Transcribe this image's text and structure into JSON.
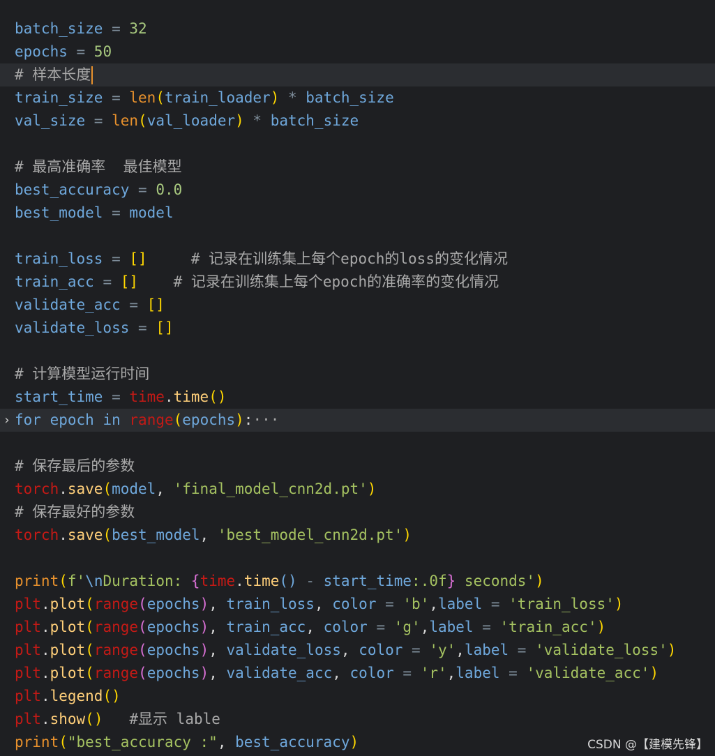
{
  "colors": {
    "background": "#1e1f22",
    "variable": "#6fa8dc",
    "operator": "#7d8c99",
    "number": "#a8c97f",
    "bracket": "#ffd700",
    "paren_inner": "#da70d6",
    "builtin": "#e8912d",
    "module": "#c41a16",
    "method": "#ffcf7a",
    "string": "#a5c261",
    "comment": "#a9a9a9",
    "keyword": "#6fa8dc",
    "plain": "#d4d4d4"
  },
  "code_lines": [
    {
      "tokens": [
        {
          "t": "batch_size",
          "c": "variable"
        },
        {
          "t": " = ",
          "c": "operator"
        },
        {
          "t": "32",
          "c": "number"
        }
      ]
    },
    {
      "tokens": [
        {
          "t": "epochs",
          "c": "variable"
        },
        {
          "t": " = ",
          "c": "operator"
        },
        {
          "t": "50",
          "c": "number"
        }
      ]
    },
    {
      "current": true,
      "caret": true,
      "tokens": [
        {
          "t": "# 样本长度",
          "c": "comment"
        }
      ]
    },
    {
      "tokens": [
        {
          "t": "train_size",
          "c": "variable"
        },
        {
          "t": " = ",
          "c": "operator"
        },
        {
          "t": "len",
          "c": "builtin"
        },
        {
          "t": "(",
          "c": "bracket"
        },
        {
          "t": "train_loader",
          "c": "variable"
        },
        {
          "t": ")",
          "c": "bracket"
        },
        {
          "t": " * ",
          "c": "operator"
        },
        {
          "t": "batch_size",
          "c": "variable"
        }
      ]
    },
    {
      "tokens": [
        {
          "t": "val_size",
          "c": "variable"
        },
        {
          "t": " = ",
          "c": "operator"
        },
        {
          "t": "len",
          "c": "builtin"
        },
        {
          "t": "(",
          "c": "bracket"
        },
        {
          "t": "val_loader",
          "c": "variable"
        },
        {
          "t": ")",
          "c": "bracket"
        },
        {
          "t": " * ",
          "c": "operator"
        },
        {
          "t": "batch_size",
          "c": "variable"
        }
      ]
    },
    {
      "tokens": []
    },
    {
      "tokens": [
        {
          "t": "# 最高准确率  最佳模型",
          "c": "comment"
        }
      ]
    },
    {
      "tokens": [
        {
          "t": "best_accuracy",
          "c": "variable"
        },
        {
          "t": " = ",
          "c": "operator"
        },
        {
          "t": "0.0",
          "c": "number"
        }
      ]
    },
    {
      "tokens": [
        {
          "t": "best_model",
          "c": "variable"
        },
        {
          "t": " = ",
          "c": "operator"
        },
        {
          "t": "model",
          "c": "variable"
        }
      ]
    },
    {
      "tokens": []
    },
    {
      "tokens": [
        {
          "t": "train_loss",
          "c": "variable"
        },
        {
          "t": " = ",
          "c": "operator"
        },
        {
          "t": "[]",
          "c": "bracket"
        },
        {
          "t": "     # 记录在训练集上每个epoch的loss的变化情况",
          "c": "comment"
        }
      ]
    },
    {
      "tokens": [
        {
          "t": "train_acc",
          "c": "variable"
        },
        {
          "t": " = ",
          "c": "operator"
        },
        {
          "t": "[]",
          "c": "bracket"
        },
        {
          "t": "    # 记录在训练集上每个epoch的准确率的变化情况",
          "c": "comment"
        }
      ]
    },
    {
      "tokens": [
        {
          "t": "validate_acc",
          "c": "variable"
        },
        {
          "t": " = ",
          "c": "operator"
        },
        {
          "t": "[]",
          "c": "bracket"
        }
      ]
    },
    {
      "tokens": [
        {
          "t": "validate_loss",
          "c": "variable"
        },
        {
          "t": " = ",
          "c": "operator"
        },
        {
          "t": "[]",
          "c": "bracket"
        }
      ]
    },
    {
      "tokens": []
    },
    {
      "tokens": [
        {
          "t": "# 计算模型运行时间",
          "c": "comment"
        }
      ]
    },
    {
      "tokens": [
        {
          "t": "start_time",
          "c": "variable"
        },
        {
          "t": " = ",
          "c": "operator"
        },
        {
          "t": "time",
          "c": "module"
        },
        {
          "t": ".",
          "c": "plain"
        },
        {
          "t": "time",
          "c": "method"
        },
        {
          "t": "()",
          "c": "bracket"
        }
      ]
    },
    {
      "folded": true,
      "fold_arrow": "›",
      "tokens": [
        {
          "t": "for",
          "c": "keyword"
        },
        {
          "t": " epoch ",
          "c": "variable"
        },
        {
          "t": "in",
          "c": "keyword"
        },
        {
          "t": " ",
          "c": "plain"
        },
        {
          "t": "range",
          "c": "module"
        },
        {
          "t": "(",
          "c": "bracket"
        },
        {
          "t": "epochs",
          "c": "variable"
        },
        {
          "t": ")",
          "c": "bracket"
        },
        {
          "t": ":",
          "c": "plain"
        },
        {
          "t": "···",
          "c": "comment"
        }
      ]
    },
    {
      "tokens": []
    },
    {
      "tokens": [
        {
          "t": "# 保存最后的参数",
          "c": "comment"
        }
      ]
    },
    {
      "tokens": [
        {
          "t": "torch",
          "c": "module"
        },
        {
          "t": ".",
          "c": "plain"
        },
        {
          "t": "save",
          "c": "method"
        },
        {
          "t": "(",
          "c": "bracket"
        },
        {
          "t": "model",
          "c": "variable"
        },
        {
          "t": ", ",
          "c": "plain"
        },
        {
          "t": "'final_model_cnn2d.pt'",
          "c": "string"
        },
        {
          "t": ")",
          "c": "bracket"
        }
      ]
    },
    {
      "tokens": [
        {
          "t": "# 保存最好的参数",
          "c": "comment"
        }
      ]
    },
    {
      "tokens": [
        {
          "t": "torch",
          "c": "module"
        },
        {
          "t": ".",
          "c": "plain"
        },
        {
          "t": "save",
          "c": "method"
        },
        {
          "t": "(",
          "c": "bracket"
        },
        {
          "t": "best_model",
          "c": "variable"
        },
        {
          "t": ", ",
          "c": "plain"
        },
        {
          "t": "'best_model_cnn2d.pt'",
          "c": "string"
        },
        {
          "t": ")",
          "c": "bracket"
        }
      ]
    },
    {
      "tokens": []
    },
    {
      "tokens": [
        {
          "t": "print",
          "c": "builtin"
        },
        {
          "t": "(",
          "c": "bracket"
        },
        {
          "t": "f'",
          "c": "string"
        },
        {
          "t": "\\n",
          "c": "variable"
        },
        {
          "t": "Duration: ",
          "c": "string"
        },
        {
          "t": "{",
          "c": "paren_inner"
        },
        {
          "t": "time",
          "c": "module"
        },
        {
          "t": ".",
          "c": "plain"
        },
        {
          "t": "time",
          "c": "method"
        },
        {
          "t": "()",
          "c": "variable"
        },
        {
          "t": " - ",
          "c": "operator"
        },
        {
          "t": "start_time",
          "c": "variable"
        },
        {
          "t": ":.0f",
          "c": "string"
        },
        {
          "t": "}",
          "c": "paren_inner"
        },
        {
          "t": " seconds'",
          "c": "string"
        },
        {
          "t": ")",
          "c": "bracket"
        }
      ]
    },
    {
      "tokens": [
        {
          "t": "plt",
          "c": "module"
        },
        {
          "t": ".",
          "c": "plain"
        },
        {
          "t": "plot",
          "c": "method"
        },
        {
          "t": "(",
          "c": "bracket"
        },
        {
          "t": "range",
          "c": "module"
        },
        {
          "t": "(",
          "c": "paren_inner"
        },
        {
          "t": "epochs",
          "c": "variable"
        },
        {
          "t": ")",
          "c": "paren_inner"
        },
        {
          "t": ", ",
          "c": "plain"
        },
        {
          "t": "train_loss",
          "c": "variable"
        },
        {
          "t": ", ",
          "c": "plain"
        },
        {
          "t": "color",
          "c": "variable"
        },
        {
          "t": " = ",
          "c": "operator"
        },
        {
          "t": "'b'",
          "c": "string"
        },
        {
          "t": ",",
          "c": "plain"
        },
        {
          "t": "label",
          "c": "variable"
        },
        {
          "t": " = ",
          "c": "operator"
        },
        {
          "t": "'train_loss'",
          "c": "string"
        },
        {
          "t": ")",
          "c": "bracket"
        }
      ]
    },
    {
      "tokens": [
        {
          "t": "plt",
          "c": "module"
        },
        {
          "t": ".",
          "c": "plain"
        },
        {
          "t": "plot",
          "c": "method"
        },
        {
          "t": "(",
          "c": "bracket"
        },
        {
          "t": "range",
          "c": "module"
        },
        {
          "t": "(",
          "c": "paren_inner"
        },
        {
          "t": "epochs",
          "c": "variable"
        },
        {
          "t": ")",
          "c": "paren_inner"
        },
        {
          "t": ", ",
          "c": "plain"
        },
        {
          "t": "train_acc",
          "c": "variable"
        },
        {
          "t": ", ",
          "c": "plain"
        },
        {
          "t": "color",
          "c": "variable"
        },
        {
          "t": " = ",
          "c": "operator"
        },
        {
          "t": "'g'",
          "c": "string"
        },
        {
          "t": ",",
          "c": "plain"
        },
        {
          "t": "label",
          "c": "variable"
        },
        {
          "t": " = ",
          "c": "operator"
        },
        {
          "t": "'train_acc'",
          "c": "string"
        },
        {
          "t": ")",
          "c": "bracket"
        }
      ]
    },
    {
      "tokens": [
        {
          "t": "plt",
          "c": "module"
        },
        {
          "t": ".",
          "c": "plain"
        },
        {
          "t": "plot",
          "c": "method"
        },
        {
          "t": "(",
          "c": "bracket"
        },
        {
          "t": "range",
          "c": "module"
        },
        {
          "t": "(",
          "c": "paren_inner"
        },
        {
          "t": "epochs",
          "c": "variable"
        },
        {
          "t": ")",
          "c": "paren_inner"
        },
        {
          "t": ", ",
          "c": "plain"
        },
        {
          "t": "validate_loss",
          "c": "variable"
        },
        {
          "t": ", ",
          "c": "plain"
        },
        {
          "t": "color",
          "c": "variable"
        },
        {
          "t": " = ",
          "c": "operator"
        },
        {
          "t": "'y'",
          "c": "string"
        },
        {
          "t": ",",
          "c": "plain"
        },
        {
          "t": "label",
          "c": "variable"
        },
        {
          "t": " = ",
          "c": "operator"
        },
        {
          "t": "'validate_loss'",
          "c": "string"
        },
        {
          "t": ")",
          "c": "bracket"
        }
      ]
    },
    {
      "tokens": [
        {
          "t": "plt",
          "c": "module"
        },
        {
          "t": ".",
          "c": "plain"
        },
        {
          "t": "plot",
          "c": "method"
        },
        {
          "t": "(",
          "c": "bracket"
        },
        {
          "t": "range",
          "c": "module"
        },
        {
          "t": "(",
          "c": "paren_inner"
        },
        {
          "t": "epochs",
          "c": "variable"
        },
        {
          "t": ")",
          "c": "paren_inner"
        },
        {
          "t": ", ",
          "c": "plain"
        },
        {
          "t": "validate_acc",
          "c": "variable"
        },
        {
          "t": ", ",
          "c": "plain"
        },
        {
          "t": "color",
          "c": "variable"
        },
        {
          "t": " = ",
          "c": "operator"
        },
        {
          "t": "'r'",
          "c": "string"
        },
        {
          "t": ",",
          "c": "plain"
        },
        {
          "t": "label",
          "c": "variable"
        },
        {
          "t": " = ",
          "c": "operator"
        },
        {
          "t": "'validate_acc'",
          "c": "string"
        },
        {
          "t": ")",
          "c": "bracket"
        }
      ]
    },
    {
      "tokens": [
        {
          "t": "plt",
          "c": "module"
        },
        {
          "t": ".",
          "c": "plain"
        },
        {
          "t": "legend",
          "c": "method"
        },
        {
          "t": "()",
          "c": "bracket"
        }
      ]
    },
    {
      "tokens": [
        {
          "t": "plt",
          "c": "module"
        },
        {
          "t": ".",
          "c": "plain"
        },
        {
          "t": "show",
          "c": "method"
        },
        {
          "t": "()",
          "c": "bracket"
        },
        {
          "t": "   #显示 lable",
          "c": "comment"
        }
      ]
    },
    {
      "tokens": [
        {
          "t": "print",
          "c": "builtin"
        },
        {
          "t": "(",
          "c": "bracket"
        },
        {
          "t": "\"best_accuracy :\"",
          "c": "string"
        },
        {
          "t": ", ",
          "c": "plain"
        },
        {
          "t": "best_accuracy",
          "c": "variable"
        },
        {
          "t": ")",
          "c": "bracket"
        }
      ]
    }
  ],
  "watermark": "CSDN @【建模先锋】"
}
